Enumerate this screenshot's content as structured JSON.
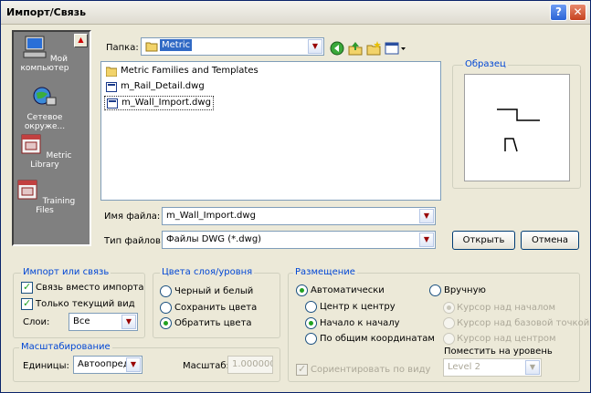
{
  "window": {
    "title": "Импорт/Связь",
    "help_glyph": "?",
    "close_glyph": "✕"
  },
  "places": [
    {
      "label": "Мой компьютер",
      "icon": "my-computer-icon"
    },
    {
      "label": "Сетевое окруже...",
      "icon": "network-icon"
    },
    {
      "label": "Metric Library",
      "icon": "library-folder-icon"
    },
    {
      "label": "Training Files",
      "icon": "training-folder-icon"
    }
  ],
  "folder": {
    "label": "Папка:",
    "value": "Metric"
  },
  "files": [
    {
      "name": "Metric Families and Templates",
      "type": "folder"
    },
    {
      "name": "m_Rail_Detail.dwg",
      "type": "dwg"
    },
    {
      "name": "m_Wall_Import.dwg",
      "type": "dwg",
      "selected": true
    }
  ],
  "filename": {
    "label": "Имя файла:",
    "value": "m_Wall_Import.dwg"
  },
  "filetype": {
    "label": "Тип файлов:",
    "value": "Файлы DWG (*.dwg)"
  },
  "preview": {
    "title": "Образец"
  },
  "buttons": {
    "open": "Открыть",
    "cancel": "Отмена"
  },
  "import_link": {
    "title": "Импорт или связь",
    "link_instead": "Связь вместо импорта",
    "current_view_only": "Только текущий вид",
    "layers_label": "Слои:",
    "layers_value": "Все"
  },
  "layer_colors": {
    "title": "Цвета слоя/уровня",
    "options": [
      "Черный и белый",
      "Сохранить цвета",
      "Обратить цвета"
    ],
    "selected": 2
  },
  "placement": {
    "title": "Размещение",
    "automatic": "Автоматически",
    "auto_options": [
      "Центр к центру",
      "Начало к началу",
      "По общим координатам"
    ],
    "auto_selected": 1,
    "manual": "Вручную",
    "manual_options": [
      "Курсор над началом",
      "Курсор над базовой точкой",
      "Курсор над центром"
    ],
    "manual_selected": 0,
    "level_label": "Поместить на уровень",
    "level_value": "Level 2",
    "orient_label": "Сориентировать по виду"
  },
  "scaling": {
    "title": "Масштабирование",
    "units_label": "Единицы:",
    "units_value": "Автоопреде",
    "scale_label": "Масштаб:",
    "scale_value": "1.000000"
  }
}
